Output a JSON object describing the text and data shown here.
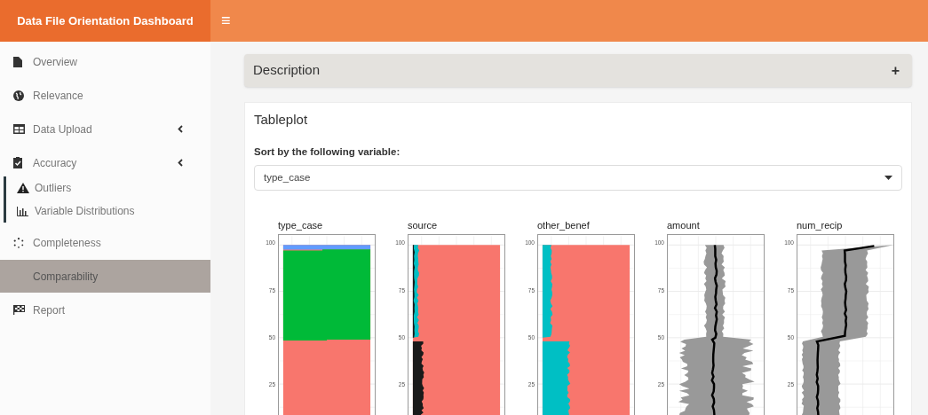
{
  "header": {
    "title": "Data File Orientation Dashboard",
    "menu_toggle": "≡"
  },
  "sidebar": {
    "items": [
      {
        "label": "Overview",
        "kind": "link",
        "selected": false
      },
      {
        "label": "Relevance",
        "kind": "link",
        "selected": false
      },
      {
        "label": "Data Upload",
        "kind": "menu",
        "selected": false
      },
      {
        "label": "Accuracy",
        "kind": "menu",
        "selected": false,
        "children": [
          {
            "label": "Outliers",
            "selected": false
          },
          {
            "label": "Variable Distributions",
            "selected": false
          }
        ]
      },
      {
        "label": "Completeness",
        "kind": "link",
        "selected": false
      },
      {
        "label": "Comparability",
        "kind": "link",
        "selected": true
      },
      {
        "label": "Report",
        "kind": "link",
        "selected": false
      }
    ]
  },
  "description_box": {
    "title": "Description",
    "toggle": "+"
  },
  "tableplot": {
    "title": "Tableplot",
    "sort_label": "Sort by the following variable:",
    "sort_value": "type_case",
    "panels": [
      {
        "title": "type_case",
        "kind": "categorical",
        "yticks": [
          "100",
          "75",
          "50",
          "25"
        ]
      },
      {
        "title": "source",
        "kind": "categorical",
        "yticks": [
          "100",
          "75",
          "50",
          "25"
        ]
      },
      {
        "title": "other_benef",
        "kind": "categorical",
        "yticks": [
          "100",
          "75",
          "50",
          "25"
        ]
      },
      {
        "title": "amount",
        "kind": "numeric",
        "yticks": [
          "100",
          "75",
          "50",
          "25"
        ]
      },
      {
        "title": "num_recip",
        "kind": "numeric",
        "yticks": [
          "100",
          "75",
          "50",
          "25"
        ]
      }
    ]
  }
}
